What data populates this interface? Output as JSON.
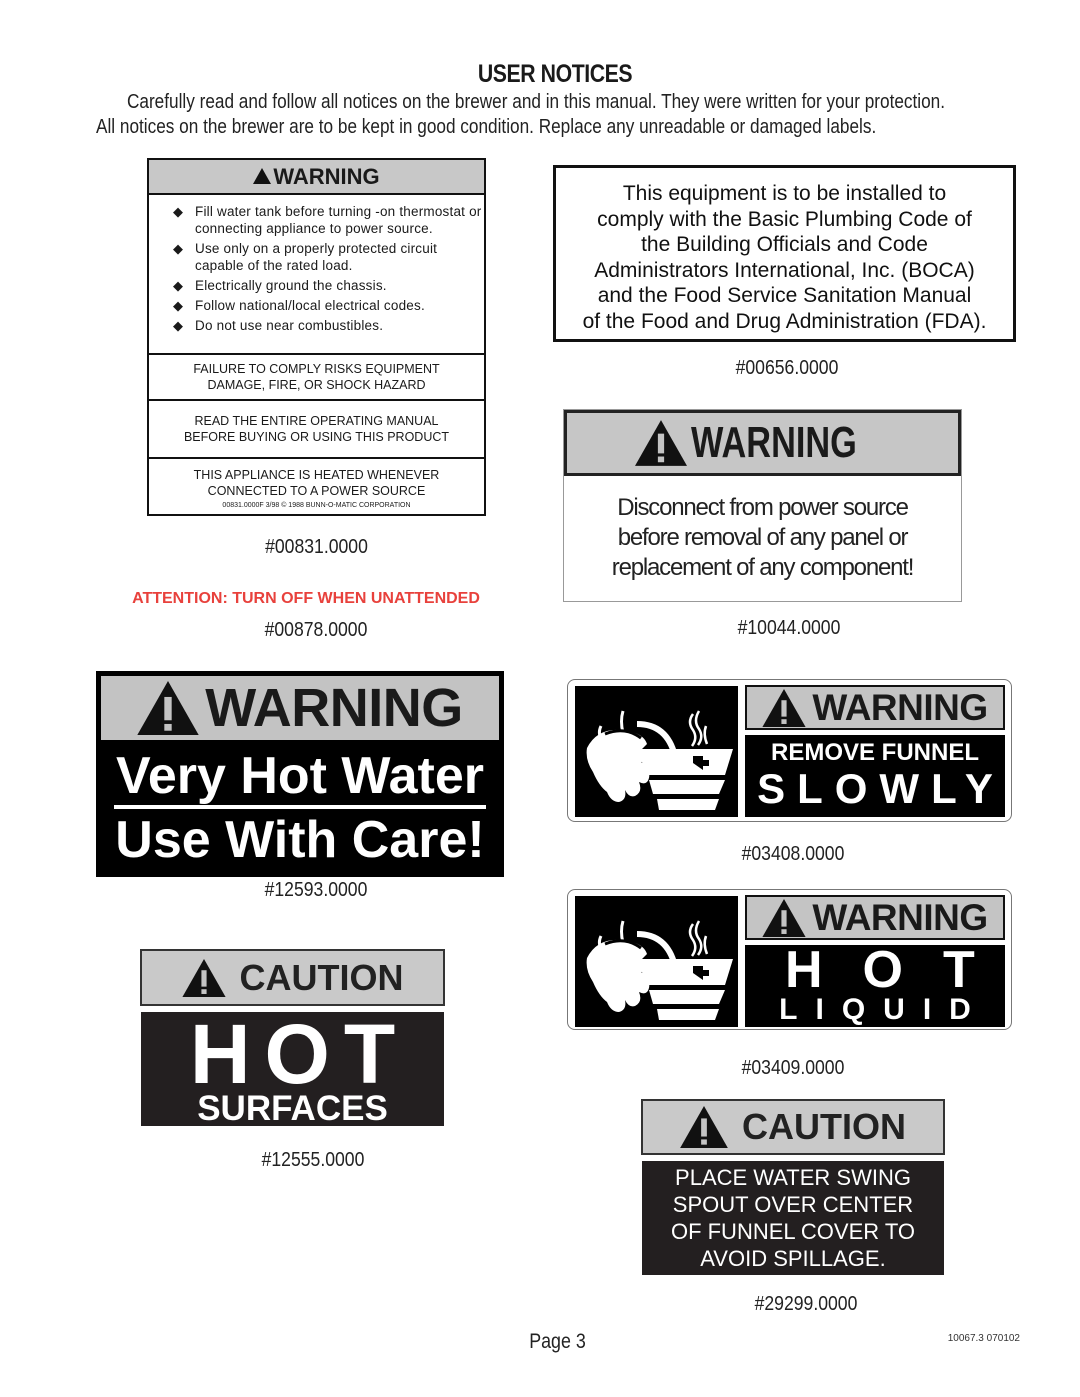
{
  "header": {
    "title": "USER NOTICES",
    "intro_lines": [
      "Carefully read and follow all notices on the brewer and in this manual. They were written for your protection.",
      "All notices on the brewer are to be kept in good condition. Replace any unreadable or damaged labels."
    ]
  },
  "labels": {
    "l00831": {
      "heading": "WARNING",
      "icon": "warning-triangle-icon",
      "bullets": [
        "Fill water tank before turning -on thermostat or connecting appliance to power source.",
        "Use only on a properly protected circuit capable of the rated load.",
        "Electrically ground the chassis.",
        "Follow national/local electrical codes.",
        "Do not use near combustibles."
      ],
      "bullet_glyph": "◆",
      "box1": [
        "FAILURE TO COMPLY RISKS EQUIPMENT",
        "DAMAGE, FIRE, OR SHOCK HAZARD"
      ],
      "box2": [
        "READ THE ENTIRE OPERATING MANUAL",
        "BEFORE BUYING OR USING THIS PRODUCT"
      ],
      "box3": [
        "THIS APPLIANCE IS HEATED WHENEVER",
        "CONNECTED TO A POWER SOURCE"
      ],
      "fine_print": "00831.0000F 3/98 © 1988 BUNN-O-MATIC CORPORATION",
      "part_number": "#00831.0000"
    },
    "l00656": {
      "lines": [
        "This equipment is to be installed to",
        "comply with the Basic Plumbing Code of",
        "the Building Officials and Code",
        "Administrators International, Inc. (BOCA)",
        "and the Food Service Sanitation Manual",
        "of the Food and Drug Administration (FDA)."
      ],
      "part_number": "#00656.0000"
    },
    "l10044": {
      "heading": "WARNING",
      "lines": [
        "Disconnect from power source",
        "before removal of any panel or",
        "replacement of any component!"
      ],
      "part_number": "#10044.0000"
    },
    "l00878": {
      "text": "ATTENTION: TURN OFF WHEN UNATTENDED",
      "color": "#e8413c",
      "part_number": "#00878.0000"
    },
    "l12593": {
      "heading": "WARNING",
      "line1": "Very Hot Water",
      "line2": "Use With Care!",
      "part_number": "#12593.0000"
    },
    "l03408": {
      "heading": "WARNING",
      "line1": "REMOVE FUNNEL",
      "line2": "SLOWLY",
      "pictogram": "hand-removing-funnel-icon",
      "part_number": "#03408.0000"
    },
    "l03409": {
      "heading": "WARNING",
      "line1": "HOT",
      "line2": "LIQUID",
      "pictogram": "hand-removing-funnel-icon",
      "part_number": "#03409.0000"
    },
    "l12555": {
      "heading": "CAUTION",
      "line1": "HOT",
      "line2": "SURFACES",
      "part_number": "#12555.0000"
    },
    "l29299": {
      "heading": "CAUTION",
      "lines": [
        "PLACE WATER SWING",
        "SPOUT OVER CENTER",
        "OF FUNNEL COVER TO",
        "AVOID SPILLAGE."
      ],
      "part_number": "#29299.0000"
    }
  },
  "footer": {
    "page": "Page 3",
    "doc_code": "10067.3 070102"
  }
}
